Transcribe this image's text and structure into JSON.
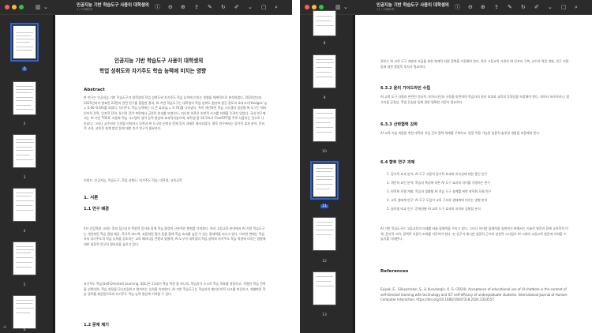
{
  "left_window": {
    "title": "인공지능 기반 학습도구 사용이 대학생의",
    "subtitle": "1 / 13페이지",
    "thumbnails": [
      {
        "num": "1",
        "selected": true
      },
      {
        "num": "2",
        "selected": false
      },
      {
        "num": "3",
        "selected": false
      },
      {
        "num": "4",
        "selected": false
      },
      {
        "num": "5",
        "selected": false
      },
      {
        "num": "6",
        "selected": false
      }
    ],
    "page": {
      "title_line1": "인공지능 기반 학습도구 사용이 대학생의",
      "title_line2": "학업 성취도와 자기주도 학습 능력에 미치는 영향",
      "abstract_heading": "Abstract",
      "abstract_text": "본 연구는 인공지능 기반 학습도구가 대학생의 학업 성취도와 자기주도 학습 능력에 미치는 영향을 체계적으로 분석하였다. 2020년부터 2025년까지 발표된 22편의 관련 연구를 종합한 결과, AI 기반 학습도구는 대학생의 학업 성취도 향상에 중간 정도의 효과크기(Hedges' g = 0.66–0.69)를 보였다. 자기주도 학습 능력에는 더 큰 효과(g = 0.76)를 나타냈다. 특히 개인화된 학습 시스템과 생성형 AI 도구는 메타인지적 전략, 인지적 전략, 동기적 전략 측면에서 긍정적 효과를 보였으나, 지나친 의존은 비판적 사고를 저해할 우려가 있었다. 국내 연구에서는 AI 기반 TOEIC 자동화 학습 시스템이 영어 능력 향상에 효과적이었으며, 대학생 중 28.5%가 ChatGPT를 주로 사용하는 것으로 나타났다. 그러나 교수자의 디지털 리터러시 부족과 AI 도구의 신뢰성 문제 등이 과제로 제시되었다. 향후 연구에서는 장기적 효과 분석, 윤리적 고려, 교육적 설계 방안 등에 대한 추가 연구가 필요하다.",
      "keywords": "키워드: 인공지능, 학습도구, 학업 성취도, 자기주도 학습, 대학생, 교육공학",
      "section1": "1. 서론",
      "section1_1": "1.1 연구 배경",
      "body1": "4차 산업혁명 시대는 정보 접근성의 폭발적 증가와 함께 학습 환경의 근본적인 변화를 가져왔다. 특히 고등교육 분야에서 AI 기반 학습도구는 개인화된 학습 경험 제공, 즉각적 피드백, 자동화된 평가 등을 통해 학습 효과를 높일 수 있는 잠재력을 지니고 있다. 이러한 변화는 학습자의 자기주도적 학습 능력을 강조하는 교육 패러다임 전환과 맞물려, AI 도구가 대학생의 학업 성취와 자기주도 학습 역량에 미치는 영향에 대한 실증적 연구의 필요성을 높이고 있다.",
      "body2": "자기주도 학습(Self-Directed Learning, SDL)은 21세기 핵심 역량 중 하나로, 학습자가 스스로 학습 목표를 설정하고, 적절한 학습 전략을 선택하며, 학습 과정을 모니터링하고 평가하는 능력을 의미한다. AI 기반 학습도구는 학습자의 메타인지적 사고를 촉진하고, 개별화된 학습 경로를 제공함으로써 자기주도 학습 능력 향상에 기여할 수 있다.",
      "section1_2": "1.2 문제 제기",
      "footer_left": "⊕"
    }
  },
  "right_window": {
    "title": "인공지능 기반 학습도구 사용이 대학생의",
    "subtitle": "11 / 13페이지",
    "thumbnails": [
      {
        "num": "8",
        "selected": false
      },
      {
        "num": "9",
        "selected": false
      },
      {
        "num": "10",
        "selected": false
      },
      {
        "num": "11",
        "selected": true
      },
      {
        "num": "12",
        "selected": false
      },
      {
        "num": "13",
        "selected": false
      }
    ],
    "page": {
      "intro_text": "정부는 AI 교육 도구 개발과 보급을 위한 체계적 지원 정책을 수립해야 한다. 특히 고등교육 기관의 AI 인프라 구축, 교수자 역량 개발, 연구 지원 등에 대한 종합적 투자가 필요하다.",
      "s632": "6.3.2 윤리 가이드라인 수립",
      "s632_text": "AI 교육 도구 사용과 관련된 윤리적 가이드라인과 규정을 마련하여 학습자의 권리 보호와 교육의 투명성을 보장해야 한다. 데이터 프라이버시, 알고리즘 공정성, 학업 진실성 등에 관한 명확한 기준이 필요하다.",
      "s633": "6.3.3 산학협력 강화",
      "s633_text": "AI 교육 기술 개발을 위한 대학과 기업 간의 협력 체계를 구축하고, 현장 적용 가능한 실용적 솔루션 개발을 지원해야 한다.",
      "s64": "6.4 향후 연구 과제",
      "list": [
        "1. 장기적 효과 분석: AI 도구 사용의 장기적 효과와 지속성에 대한 종단 연구",
        "2. 개인차 요인 분석: 학습자 특성에 따른 AI 도구 효과의 차이를 규명하는 연구",
        "3. 최적화 모델 개발: 학습자 맞춤형 AI 학습 도구 설계를 위한 최적화 모델 연구",
        "4. 교육 생태계 연구: AI 도구 도입이 교육 구조와 생태계에 미치는 영향 분석",
        "5. 글로벌 비교 연구: 문화권별 AI 교육 도구 효과의 차이와 공통점 분석"
      ],
      "closing_text": "AI 기반 학습도구는 고등교육의 미래를 바꿀 잠재력을 가지고 있다. 그러나 이러한 잠재력을 실현하기 위해서는 기술적 발전과 함께 교육학적 이해, 윤리적 고려, 정책적 지원이 조화를 이루어야 한다. 본 연구가 제시한 실증적 근거와 실천적 시사점이 AI 시대의 고등교육 발전에 기여할 수 있기를 기대한다.",
      "ref_heading": "References",
      "ref_text": "Eşiyok, E., Gökçearslan, Ş., & Kucukergin, K. G. (2024). Acceptance of educational use of AI chatbots in the context of self-directed learning with technology and ICT self-efficacy of undergraduate students. International Journal of Human–Computer Interaction. https://doi.org/10.1080/10447318.2024.2303557"
    }
  },
  "toolbar_icons": [
    "sidebar-icon",
    "chevron-down-icon",
    "info-icon",
    "zoom-out-icon",
    "zoom-in-icon",
    "share-icon",
    "highlight-icon",
    "rotate-icon",
    "markup-icon",
    "more-icon",
    "search-icon"
  ]
}
